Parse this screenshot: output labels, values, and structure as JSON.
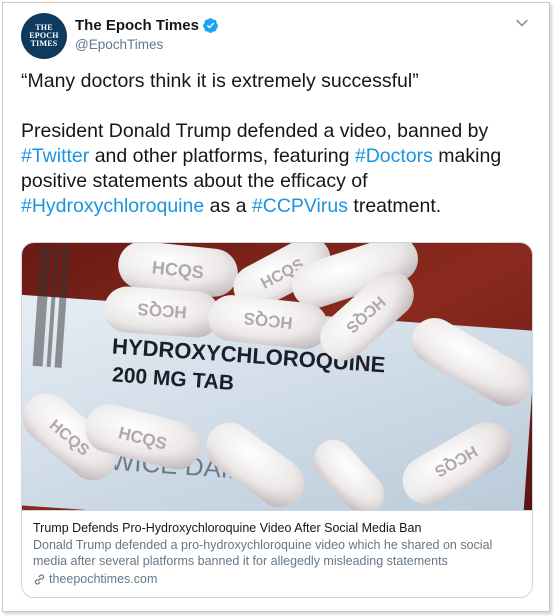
{
  "account": {
    "display_name": "The Epoch Times",
    "handle": "@EpochTimes",
    "avatar_logo_text": "THE\nEPOCH\nTIMES",
    "verified": true
  },
  "tweet": {
    "quote": "“Many doctors think it is extremely successful”",
    "body_parts": {
      "p1": "President Donald Trump defended a video, banned by ",
      "tag_twitter": "#Twitter",
      "p2": " and other platforms, featuring ",
      "tag_doctors": "#Doctors",
      "p3": " making positive statements about the efficacy of ",
      "tag_hcq": "#Hydroxychloroquine",
      "p4": " as a ",
      "tag_ccp": "#CCPVirus",
      "p5": " treatment."
    }
  },
  "card": {
    "title": "Trump Defends Pro-Hydroxychloroquine Video After Social Media Ban",
    "description": "Donald Trump defended a pro-hydroxychloroquine video which he shared on social media after several platforms banned it for allegedly misleading statements",
    "domain": "theepochtimes.com",
    "image": {
      "label_line1": "HYDROXYCHLOROQUINE",
      "label_line2": "200 MG TAB",
      "label_line3": "TWICE DAILY",
      "pill_imprint": "HCQS"
    }
  },
  "colors": {
    "link_blue": "#1b95e0",
    "verified_blue": "#1da1f2",
    "avatar_navy": "#0e3a5e",
    "muted_gray": "#657786"
  },
  "icons": [
    "verified-icon",
    "chevron-down-icon",
    "link-icon"
  ]
}
